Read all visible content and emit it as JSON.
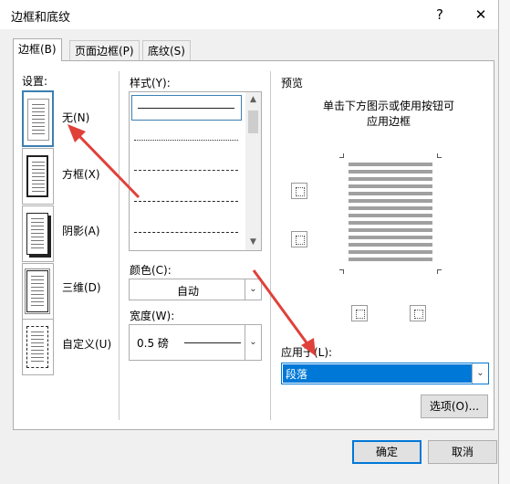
{
  "window": {
    "title": "边框和底纹",
    "help_label": "?",
    "close_label": "✕"
  },
  "tabs": [
    {
      "label": "边框(B)"
    },
    {
      "label": "页面边框(P)"
    },
    {
      "label": "底纹(S)"
    }
  ],
  "settings": {
    "heading": "设置:",
    "items": [
      {
        "label": "无(N)",
        "icon": "no-border-page-icon"
      },
      {
        "label": "方框(X)",
        "icon": "box-border-page-icon"
      },
      {
        "label": "阴影(A)",
        "icon": "shadow-border-page-icon"
      },
      {
        "label": "三维(D)",
        "icon": "3d-border-page-icon"
      },
      {
        "label": "自定义(U)",
        "icon": "custom-border-page-icon"
      }
    ]
  },
  "style": {
    "heading": "样式(Y):"
  },
  "color": {
    "label": "颜色(C):",
    "value": "自动"
  },
  "width": {
    "label": "宽度(W):",
    "value": "0.5 磅"
  },
  "preview": {
    "heading": "预览",
    "hint_line1": "单击下方图示或使用按钮可",
    "hint_line2": "应用边框"
  },
  "apply_to": {
    "label": "应用于(L):",
    "value": "段落"
  },
  "buttons": {
    "options": "选项(O)...",
    "ok": "确定",
    "cancel": "取消"
  },
  "colors": {
    "accent": "#0078d7",
    "selection": "#3c7fb1",
    "annotation_arrow": "#e0413a"
  }
}
